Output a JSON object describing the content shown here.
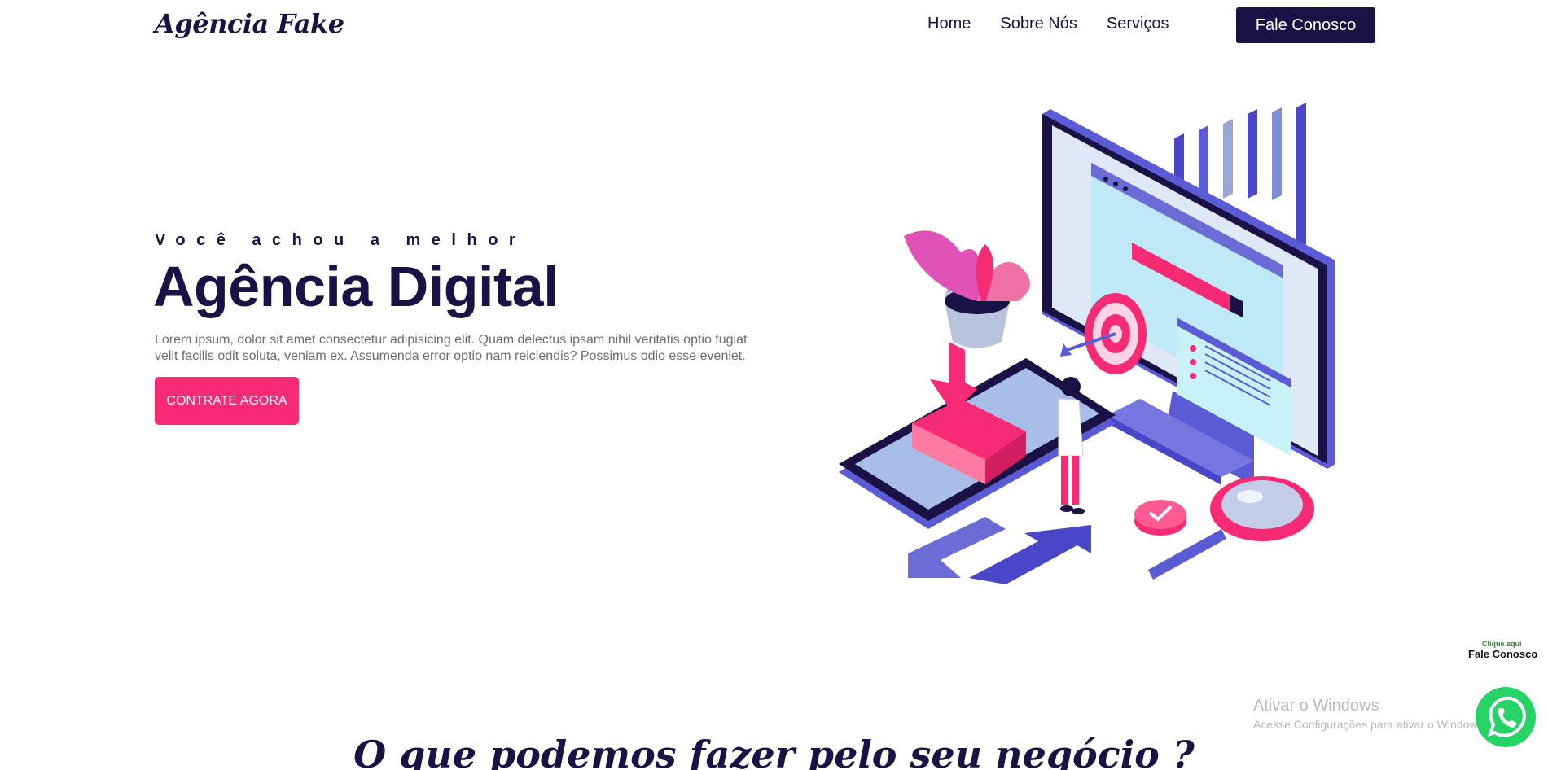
{
  "header": {
    "logo": "Agência Fake",
    "nav": [
      "Home",
      "Sobre Nós",
      "Serviços"
    ],
    "cta_label": "Fale Conosco"
  },
  "hero": {
    "eyebrow": "Você achou a melhor",
    "title": "Agência Digital",
    "text": "Lorem ipsum, dolor sit amet consectetur adipisicing elit. Quam delectus ipsam nihil veritatis optio fugiat velit facilis odit soluta, veniam ex. Assumenda error optio nam reiciendis? Possimus odio esse eveniet.",
    "button_label": "CONTRATE AGORA"
  },
  "section": {
    "title": "O que podemos fazer pelo seu negócio ?"
  },
  "whatsapp": {
    "hint": "Clique aqui",
    "label": "Fale Conosco",
    "icon": "whatsapp-icon"
  },
  "windows_watermark": {
    "title": "Ativar o Windows",
    "subtitle": "Acesse Configurações para ativar o Windows."
  },
  "colors": {
    "primary": "#1a1245",
    "accent": "#f72a74",
    "illustration_blue": "#5b5bd6",
    "whatsapp_green": "#25d366"
  }
}
